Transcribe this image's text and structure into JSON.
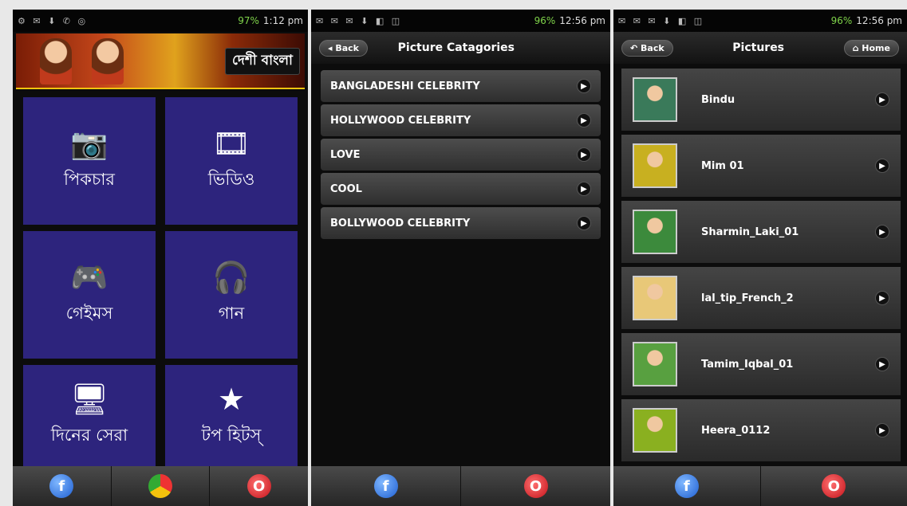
{
  "phone1": {
    "status": {
      "time": "1:12 pm",
      "battery": "97%"
    },
    "banner_title": "দেশী বাংলা",
    "tiles": [
      {
        "icon": "camera-icon",
        "glyph": "📷",
        "label": "পিকচার"
      },
      {
        "icon": "film-icon",
        "glyph": "🎞",
        "label": "ভিডিও"
      },
      {
        "icon": "gamepad-icon",
        "glyph": "🎮",
        "label": "গেইমস"
      },
      {
        "icon": "headphones-icon",
        "glyph": "🎧",
        "label": "গান"
      },
      {
        "icon": "monitor-icon",
        "glyph": "🖥",
        "label": "দিনের সেরা"
      },
      {
        "icon": "star-icon",
        "glyph": "★",
        "label": "টপ হিটস্"
      }
    ]
  },
  "phone2": {
    "status": {
      "time": "12:56 pm",
      "battery": "96%"
    },
    "back_label": "Back",
    "title": "Picture Catagories",
    "categories": [
      "BANGLADESHI CELEBRITY",
      "HOLLYWOOD CELEBRITY",
      "LOVE",
      "COOL",
      "BOLLYWOOD CELEBRITY"
    ]
  },
  "phone3": {
    "status": {
      "time": "12:56 pm",
      "battery": "96%"
    },
    "back_label": "Back",
    "title": "Pictures",
    "home_label": "Home",
    "pictures": [
      {
        "name": "Bindu",
        "color": "#3a7a5a"
      },
      {
        "name": "Mim 01",
        "color": "#c8b020"
      },
      {
        "name": "Sharmin_Laki_01",
        "color": "#3c8a3c"
      },
      {
        "name": "lal_tip_French_2",
        "color": "#e8c878"
      },
      {
        "name": "Tamim_Iqbal_01",
        "color": "#58a040"
      },
      {
        "name": "Heera_0112",
        "color": "#8ab020"
      }
    ]
  }
}
